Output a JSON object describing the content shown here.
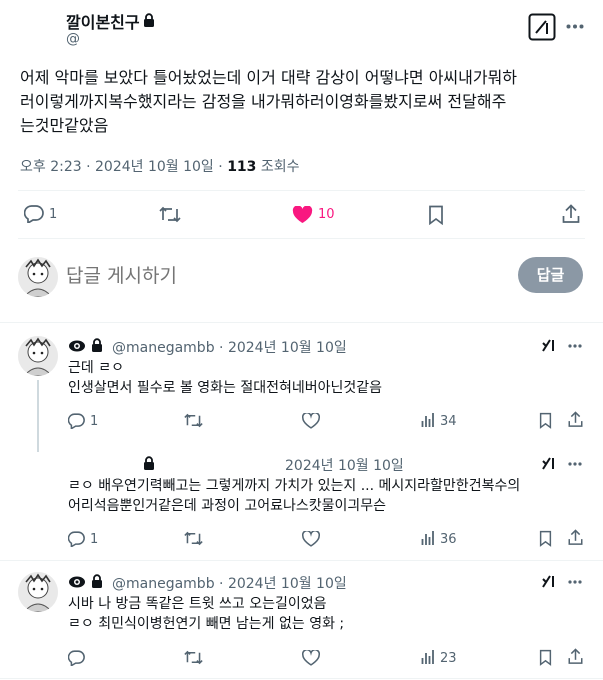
{
  "main_post": {
    "display_name": "깔이본친구",
    "handle": "@",
    "text_lines": [
      "어제 악마를 보았다 틀어놨었는데 이거 대략 감상이 어떻냐면 아씨내가뭐하",
      "러이렇게까지복수했지라는 감정을 내가뭐하러이영화를봤지로써 전달해주",
      "는것만같았음"
    ],
    "time": "오후 2:23",
    "date": "2024년 10월 10일",
    "views_count": "113",
    "views_label": "조회수",
    "replies": "1",
    "likes": "10",
    "liked_color": "#f91880"
  },
  "reply_box": {
    "placeholder": "답글 게시하기",
    "button_label": "답글"
  },
  "replies": [
    {
      "handle": "@manegambb",
      "date": "2024년 10월 10일",
      "lines": [
        "근데 ㄹㅇ",
        "인생살면서 필수로 볼 영화는 절대전혀네버아닌것같음"
      ],
      "reply_count": "1",
      "views": "34"
    },
    {
      "handle": "",
      "date": "2024년 10월 10일",
      "lines": [
        "ㄹㅇ 배우연기력빼고는 그렇게까지 가치가 있는지 ... 메시지라할만한건복수의",
        "어리석음뿐인거같은데 과정이 고어료나스캇물이긔무슨"
      ],
      "reply_count": "1",
      "views": "36"
    },
    {
      "handle": "@manegambb",
      "date": "2024년 10월 10일",
      "lines": [
        "시바 나 방금 똑같은 트윗 쓰고 오는길이었음",
        "ㄹㅇ 최민식이병헌연기 빼면 남는게 없는 영화 ;"
      ],
      "reply_count": "",
      "views": "23"
    }
  ],
  "icons": [
    "lock-icon",
    "grok-icon",
    "more-icon",
    "reply-icon",
    "retweet-icon",
    "heart-icon",
    "bookmark-icon",
    "share-icon",
    "views-icon",
    "eye-icon"
  ]
}
